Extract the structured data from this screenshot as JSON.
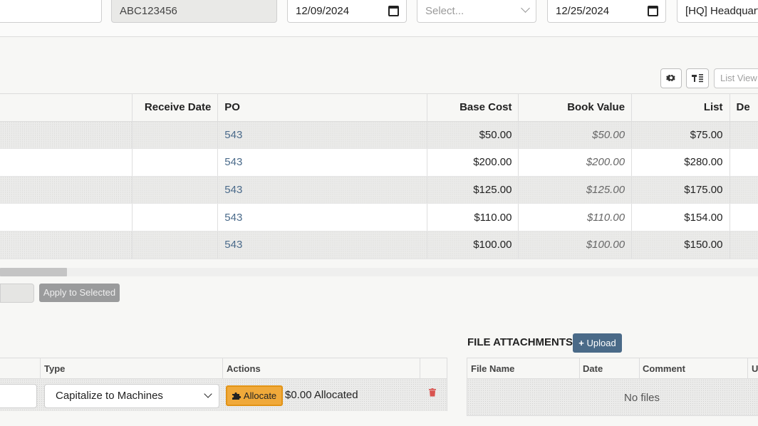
{
  "filters": {
    "code_value": "ABC123456",
    "date_from": "12/09/2024",
    "select_placeholder": "Select...",
    "date_to": "12/25/2024",
    "location": "[HQ] Headquarters"
  },
  "toolbar": {
    "list_view_label": "List View"
  },
  "table": {
    "columns": {
      "receive_date": "Receive Date",
      "po": "PO",
      "base_cost": "Base Cost",
      "book_value": "Book Value",
      "list": "List",
      "next": "De"
    },
    "rows": [
      {
        "po": "543",
        "base_cost": "$50.00",
        "book_value": "$50.00",
        "list": "$75.00"
      },
      {
        "po": "543",
        "base_cost": "$200.00",
        "book_value": "$200.00",
        "list": "$280.00"
      },
      {
        "po": "543",
        "base_cost": "$125.00",
        "book_value": "$125.00",
        "list": "$175.00"
      },
      {
        "po": "543",
        "base_cost": "$110.00",
        "book_value": "$110.00",
        "list": "$154.00"
      },
      {
        "po": "543",
        "base_cost": "$100.00",
        "book_value": "$100.00",
        "list": "$150.00"
      }
    ]
  },
  "bulk": {
    "apply_label": "Apply to Selected"
  },
  "costs": {
    "col_type": "Type",
    "col_actions": "Actions",
    "type_value": "Capitalize to Machines",
    "allocate_label": "Allocate",
    "allocated_text": "$0.00 Allocated"
  },
  "attachments": {
    "title": "FILE ATTACHMENTS",
    "upload_label": "Upload",
    "col_file_name": "File Name",
    "col_date": "Date",
    "col_comment": "Comment",
    "col_next": "U",
    "empty_text": "No files"
  },
  "colors": {
    "link": "#4a6a8a",
    "allocate": "#f0a93a",
    "upload": "#4a6a88",
    "delete": "#d9534f"
  }
}
